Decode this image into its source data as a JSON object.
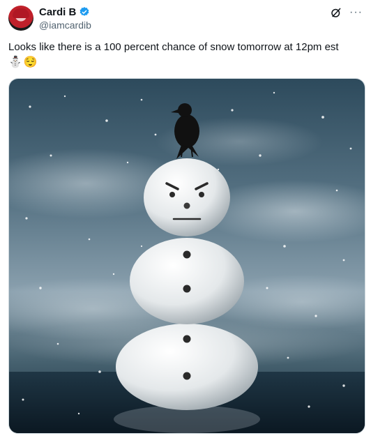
{
  "author": {
    "display_name": "Cardi B",
    "handle": "@iamcardib",
    "verified": true,
    "avatar_icon": "avatar-image"
  },
  "header_actions": {
    "grok_icon": "grok-icon",
    "more_label": "···"
  },
  "tweet": {
    "text": "Looks like there is a 100 percent chance of snow tomorrow at 12pm est",
    "emojis": [
      "⛄",
      "😌"
    ]
  },
  "media": {
    "icon": "snowman-crow-image"
  },
  "colors": {
    "text_primary": "#0f1419",
    "text_secondary": "#536471",
    "verified_blue": "#1d9bf0",
    "border": "#cfd9de"
  }
}
